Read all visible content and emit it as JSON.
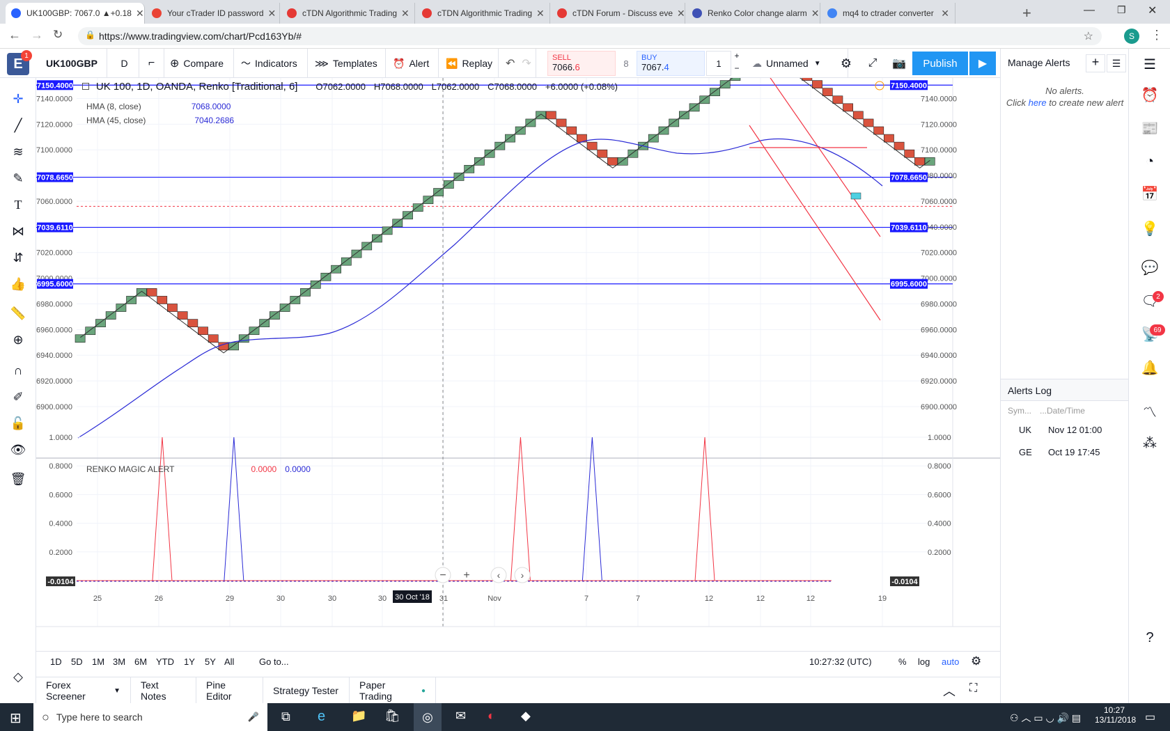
{
  "browser": {
    "tabs": [
      {
        "label": "UK100GBP: 7067.0 ▲+0.18",
        "active": true,
        "color": "#2962ff"
      },
      {
        "label": "Your cTrader ID password",
        "active": false,
        "color": "#ea4335"
      },
      {
        "label": "cTDN Algorithmic Trading",
        "active": false,
        "color": "#e53935"
      },
      {
        "label": "cTDN Algorithmic Trading",
        "active": false,
        "color": "#e53935"
      },
      {
        "label": "cTDN Forum - Discuss eve",
        "active": false,
        "color": "#e53935"
      },
      {
        "label": "Renko Color change alarm",
        "active": false,
        "color": "#3f51b5"
      },
      {
        "label": "mq4 to ctrader converter",
        "active": false,
        "color": "#4285f4"
      }
    ],
    "url": "https://www.tradingview.com/chart/Pcd163Yb/#",
    "profile_initial": "S"
  },
  "toolbar": {
    "notif_count": "1",
    "symbol": "UK100GBP",
    "interval": "D",
    "compare": "Compare",
    "indicators": "Indicators",
    "templates": "Templates",
    "alert": "Alert",
    "replay": "Replay",
    "sell_label": "SELL",
    "sell_price_main": "7066.",
    "sell_price_last": "6",
    "spread": "8",
    "buy_label": "BUY",
    "buy_price_main": "7067.",
    "buy_price_last": "4",
    "qty": "1",
    "layout_name": "Unnamed",
    "publish": "Publish"
  },
  "legend": {
    "title": "UK 100, 1D, OANDA, Renko [Traditional, 6]",
    "o": "O7062.0000",
    "h": "H7068.0000",
    "l": "L7062.0000",
    "c": "C7068.0000",
    "change": "+6.0000 (+0.08%)",
    "hma8": "HMA (8, close)",
    "hma8_val": "7068.0000",
    "hma45": "HMA (45, close)",
    "hma45_val": "7040.2686",
    "sub": "RENKO MAGIC ALERT",
    "sub_v1": "0.0000",
    "sub_v2": "0.0000"
  },
  "chart_data": {
    "type": "renko",
    "price_ticks": [
      "7140.0000",
      "7120.0000",
      "7100.0000",
      "7080.0000",
      "7060.0000",
      "7040.0000",
      "7020.0000",
      "7000.0000",
      "6980.0000",
      "6960.0000",
      "6940.0000",
      "6920.0000",
      "6900.0000"
    ],
    "price_ticks_values": [
      7140,
      7120,
      7100,
      7080,
      7060,
      7040,
      7020,
      7000,
      6980,
      6960,
      6940,
      6920,
      6900
    ],
    "ylim": [
      6892,
      7150
    ],
    "hlines": [
      {
        "label": "7150.4000",
        "value": 7150.4
      },
      {
        "label": "7078.6650",
        "value": 7078.665
      },
      {
        "label": "7039.6110",
        "value": 7039.611
      },
      {
        "label": "6995.6000",
        "value": 6995.6
      }
    ],
    "dashed_line": 7056,
    "box_size": 6,
    "start_price": 6950,
    "moves": [
      1,
      1,
      1,
      1,
      1,
      1,
      1,
      -1,
      -1,
      -1,
      -1,
      -1,
      -1,
      -1,
      -1,
      1,
      1,
      1,
      1,
      1,
      1,
      1,
      1,
      1,
      1,
      1,
      1,
      1,
      1,
      1,
      1,
      1,
      1,
      1,
      1,
      1,
      1,
      1,
      1,
      1,
      1,
      1,
      1,
      1,
      1,
      1,
      -1,
      -1,
      -1,
      -1,
      -1,
      -1,
      -1,
      1,
      1,
      1,
      1,
      1,
      1,
      1,
      1,
      1,
      1,
      1,
      1,
      1,
      1,
      1,
      -1,
      -1,
      -1,
      -1,
      -1,
      -1,
      -1,
      -1,
      -1,
      -1,
      -1,
      -1,
      -1,
      -1,
      -1,
      1
    ],
    "x_ticks": [
      "25",
      "26",
      "29",
      "30",
      "30",
      "30",
      "31",
      "Nov",
      "7",
      "7",
      "12",
      "12",
      "12",
      "19"
    ],
    "x_cursor": "30 Oct '18",
    "sub_ticks": [
      "1.0000",
      "0.8000",
      "0.6000",
      "0.4000",
      "0.2000"
    ],
    "sub_ticks_values": [
      1,
      0.8,
      0.6,
      0.4,
      0.2
    ],
    "sub_last": "-0.0104",
    "sub_spikes": [
      {
        "color": "red",
        "at": 8
      },
      {
        "color": "blue",
        "at": 15
      },
      {
        "color": "red",
        "at": 43
      },
      {
        "color": "blue",
        "at": 50
      },
      {
        "color": "red",
        "at": 61
      }
    ]
  },
  "bottom": {
    "ranges": [
      "1D",
      "5D",
      "1M",
      "3M",
      "6M",
      "YTD",
      "1Y",
      "5Y",
      "All"
    ],
    "goto": "Go to...",
    "time": "10:27:32 (UTC)",
    "pct": "%",
    "log": "log",
    "auto": "auto"
  },
  "panels": [
    "Forex Screener",
    "Text Notes",
    "Pine Editor",
    "Strategy Tester",
    "Paper Trading"
  ],
  "alerts": {
    "title": "Manage Alerts",
    "empty1": "No alerts.",
    "empty2a": "Click ",
    "empty2link": "here",
    "empty2b": " to create new alert",
    "log_title": "Alerts Log",
    "col_sym": "Sym...",
    "col_date": "...Date/Time",
    "rows": [
      {
        "sym": "UK",
        "date": "Nov 12 01:00"
      },
      {
        "sym": "GE",
        "date": "Oct 19 17:45"
      }
    ]
  },
  "rightbar": {
    "badge_chat": "2",
    "badge_ideas": "69"
  },
  "taskbar": {
    "search": "Type here to search",
    "time": "10:27",
    "date": "13/11/2018"
  }
}
